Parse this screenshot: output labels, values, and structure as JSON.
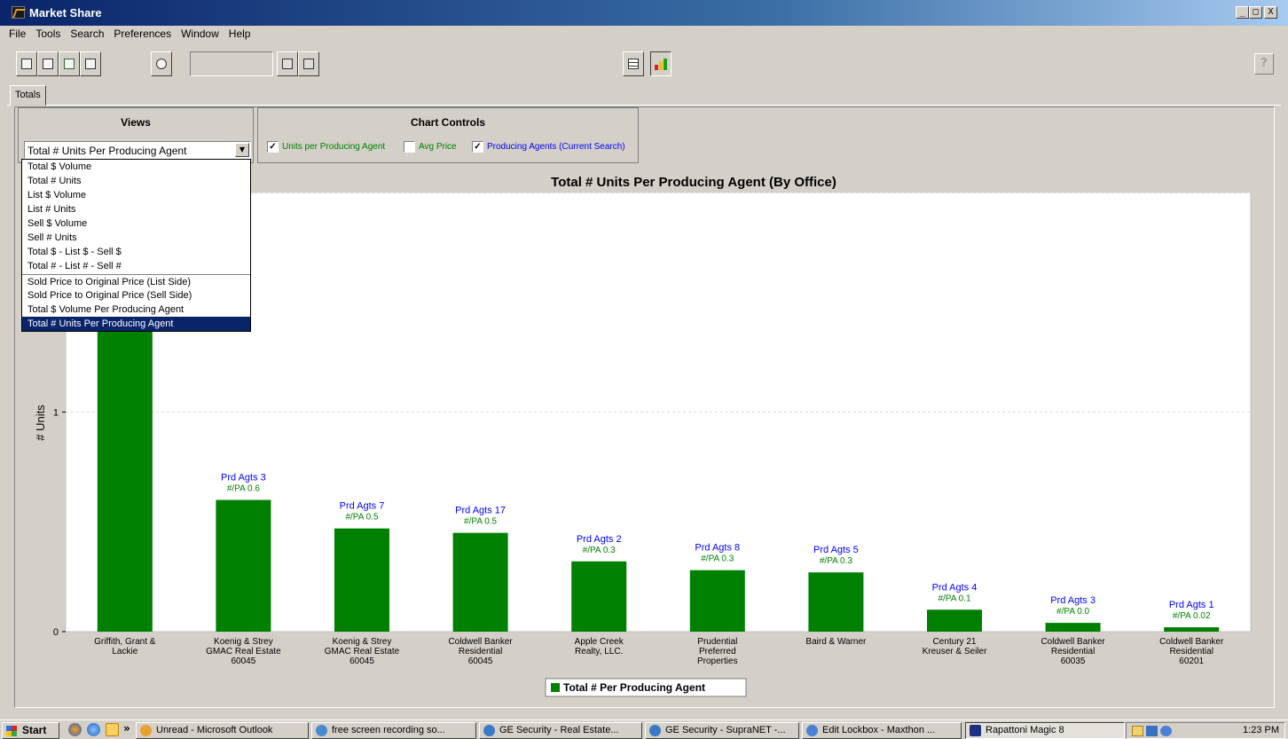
{
  "window": {
    "title": "Market Share",
    "min": "_",
    "max": "□",
    "close": "X"
  },
  "menu": [
    "File",
    "Tools",
    "Search",
    "Preferences",
    "Window",
    "Help"
  ],
  "toolbar": {
    "search_value": "",
    "help": "?"
  },
  "tabs": [
    "Totals"
  ],
  "views": {
    "title": "Views",
    "selected": "Total # Units Per Producing Agent",
    "options": [
      "Total $ Volume",
      "Total # Units",
      "List $ Volume",
      "List # Units",
      "Sell $ Volume",
      "Sell # Units",
      "Total $ - List $ - Sell $",
      "Total # - List # - Sell #",
      "Sold Price to Original Price (List Side)",
      "Sold Price to Original Price (Sell Side)",
      "Total $ Volume Per Producing Agent",
      "Total # Units Per Producing Agent"
    ]
  },
  "chart_controls": {
    "title": "Chart Controls",
    "checkboxes": [
      {
        "label": "Units per Producing Agent",
        "checked": true,
        "color": "#008000"
      },
      {
        "label": "Avg Price",
        "checked": false,
        "color": "#008000"
      },
      {
        "label": "Producing Agents (Current Search)",
        "checked": true,
        "color": "#0000ff"
      }
    ]
  },
  "chart_data": {
    "type": "bar",
    "title": "Total # Units Per Producing Agent (By Office)",
    "ylabel": "# Units",
    "yticks": [
      "0",
      "1"
    ],
    "ylim": [
      0,
      2
    ],
    "legend": "Total # Per Producing Agent",
    "bar_color": "#008000",
    "categories": [
      [
        "Griffith, Grant &",
        "Lackie"
      ],
      [
        "Koenig & Strey",
        "GMAC Real Estate",
        "60045"
      ],
      [
        "Koenig & Strey",
        "GMAC Real Estate",
        "60045"
      ],
      [
        "Coldwell Banker",
        "Residential",
        "60045"
      ],
      [
        "Apple Creek",
        "Realty, LLC."
      ],
      [
        "Prudential",
        "Preferred",
        "Properties"
      ],
      [
        "Baird & Warner"
      ],
      [
        "Century 21",
        "Kreuser & Seiler"
      ],
      [
        "Coldwell Banker",
        "Residential",
        "60035"
      ],
      [
        "Coldwell Banker",
        "Residential",
        "60201"
      ]
    ],
    "values": [
      1.88,
      0.6,
      0.47,
      0.45,
      0.32,
      0.28,
      0.27,
      0.1,
      0.04,
      0.02
    ],
    "labels_agents": [
      "",
      "Prd Agts 3",
      "Prd Agts 7",
      "Prd Agts 17",
      "Prd Agts 2",
      "Prd Agts 8",
      "Prd Agts 5",
      "Prd Agts 4",
      "Prd Agts 3",
      "Prd Agts 1"
    ],
    "labels_pa": [
      "",
      "#/PA 0.6",
      "#/PA 0.5",
      "#/PA 0.5",
      "#/PA 0.3",
      "#/PA 0.3",
      "#/PA 0.3",
      "#/PA 0.1",
      "#/PA 0.0",
      "#/PA 0.02"
    ]
  },
  "taskbar": {
    "start": "Start",
    "more": "»",
    "tasks": [
      {
        "label": "Unread - Microsoft Outlook",
        "color": "#e8a030"
      },
      {
        "label": "free screen recording so...",
        "color": "#4a8ad0"
      },
      {
        "label": "GE Security - Real Estate...",
        "color": "#3a78c8"
      },
      {
        "label": "GE Security - SupraNET -...",
        "color": "#3a78c8"
      },
      {
        "label": "Edit Lockbox - Maxthon ...",
        "color": "#4c7fd6"
      },
      {
        "label": "Rapattoni Magic 8",
        "color": "#203080"
      }
    ],
    "clock": "1:23 PM"
  }
}
